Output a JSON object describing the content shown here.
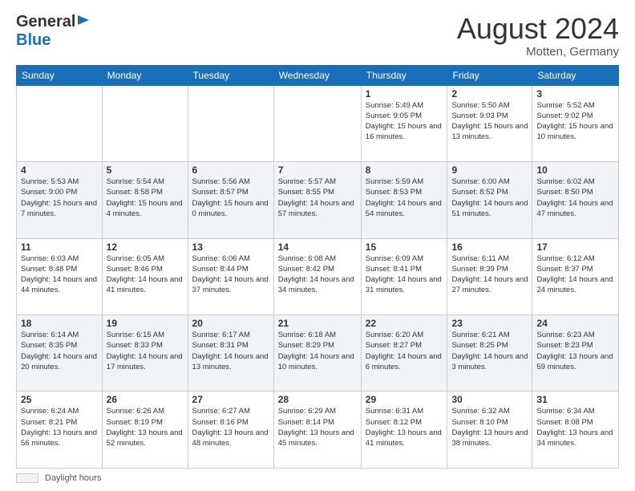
{
  "header": {
    "logo_line1": "General",
    "logo_line2": "Blue",
    "month_title": "August 2024",
    "location": "Motten, Germany"
  },
  "days_of_week": [
    "Sunday",
    "Monday",
    "Tuesday",
    "Wednesday",
    "Thursday",
    "Friday",
    "Saturday"
  ],
  "weeks": [
    [
      {
        "day": "",
        "detail": ""
      },
      {
        "day": "",
        "detail": ""
      },
      {
        "day": "",
        "detail": ""
      },
      {
        "day": "",
        "detail": ""
      },
      {
        "day": "1",
        "detail": "Sunrise: 5:49 AM\nSunset: 9:05 PM\nDaylight: 15 hours and 16 minutes."
      },
      {
        "day": "2",
        "detail": "Sunrise: 5:50 AM\nSunset: 9:03 PM\nDaylight: 15 hours and 13 minutes."
      },
      {
        "day": "3",
        "detail": "Sunrise: 5:52 AM\nSunset: 9:02 PM\nDaylight: 15 hours and 10 minutes."
      }
    ],
    [
      {
        "day": "4",
        "detail": "Sunrise: 5:53 AM\nSunset: 9:00 PM\nDaylight: 15 hours and 7 minutes."
      },
      {
        "day": "5",
        "detail": "Sunrise: 5:54 AM\nSunset: 8:58 PM\nDaylight: 15 hours and 4 minutes."
      },
      {
        "day": "6",
        "detail": "Sunrise: 5:56 AM\nSunset: 8:57 PM\nDaylight: 15 hours and 0 minutes."
      },
      {
        "day": "7",
        "detail": "Sunrise: 5:57 AM\nSunset: 8:55 PM\nDaylight: 14 hours and 57 minutes."
      },
      {
        "day": "8",
        "detail": "Sunrise: 5:59 AM\nSunset: 8:53 PM\nDaylight: 14 hours and 54 minutes."
      },
      {
        "day": "9",
        "detail": "Sunrise: 6:00 AM\nSunset: 8:52 PM\nDaylight: 14 hours and 51 minutes."
      },
      {
        "day": "10",
        "detail": "Sunrise: 6:02 AM\nSunset: 8:50 PM\nDaylight: 14 hours and 47 minutes."
      }
    ],
    [
      {
        "day": "11",
        "detail": "Sunrise: 6:03 AM\nSunset: 8:48 PM\nDaylight: 14 hours and 44 minutes."
      },
      {
        "day": "12",
        "detail": "Sunrise: 6:05 AM\nSunset: 8:46 PM\nDaylight: 14 hours and 41 minutes."
      },
      {
        "day": "13",
        "detail": "Sunrise: 6:06 AM\nSunset: 8:44 PM\nDaylight: 14 hours and 37 minutes."
      },
      {
        "day": "14",
        "detail": "Sunrise: 6:08 AM\nSunset: 8:42 PM\nDaylight: 14 hours and 34 minutes."
      },
      {
        "day": "15",
        "detail": "Sunrise: 6:09 AM\nSunset: 8:41 PM\nDaylight: 14 hours and 31 minutes."
      },
      {
        "day": "16",
        "detail": "Sunrise: 6:11 AM\nSunset: 8:39 PM\nDaylight: 14 hours and 27 minutes."
      },
      {
        "day": "17",
        "detail": "Sunrise: 6:12 AM\nSunset: 8:37 PM\nDaylight: 14 hours and 24 minutes."
      }
    ],
    [
      {
        "day": "18",
        "detail": "Sunrise: 6:14 AM\nSunset: 8:35 PM\nDaylight: 14 hours and 20 minutes."
      },
      {
        "day": "19",
        "detail": "Sunrise: 6:15 AM\nSunset: 8:33 PM\nDaylight: 14 hours and 17 minutes."
      },
      {
        "day": "20",
        "detail": "Sunrise: 6:17 AM\nSunset: 8:31 PM\nDaylight: 14 hours and 13 minutes."
      },
      {
        "day": "21",
        "detail": "Sunrise: 6:18 AM\nSunset: 8:29 PM\nDaylight: 14 hours and 10 minutes."
      },
      {
        "day": "22",
        "detail": "Sunrise: 6:20 AM\nSunset: 8:27 PM\nDaylight: 14 hours and 6 minutes."
      },
      {
        "day": "23",
        "detail": "Sunrise: 6:21 AM\nSunset: 8:25 PM\nDaylight: 14 hours and 3 minutes."
      },
      {
        "day": "24",
        "detail": "Sunrise: 6:23 AM\nSunset: 8:23 PM\nDaylight: 13 hours and 59 minutes."
      }
    ],
    [
      {
        "day": "25",
        "detail": "Sunrise: 6:24 AM\nSunset: 8:21 PM\nDaylight: 13 hours and 56 minutes."
      },
      {
        "day": "26",
        "detail": "Sunrise: 6:26 AM\nSunset: 8:19 PM\nDaylight: 13 hours and 52 minutes."
      },
      {
        "day": "27",
        "detail": "Sunrise: 6:27 AM\nSunset: 8:16 PM\nDaylight: 13 hours and 48 minutes."
      },
      {
        "day": "28",
        "detail": "Sunrise: 6:29 AM\nSunset: 8:14 PM\nDaylight: 13 hours and 45 minutes."
      },
      {
        "day": "29",
        "detail": "Sunrise: 6:31 AM\nSunset: 8:12 PM\nDaylight: 13 hours and 41 minutes."
      },
      {
        "day": "30",
        "detail": "Sunrise: 6:32 AM\nSunset: 8:10 PM\nDaylight: 13 hours and 38 minutes."
      },
      {
        "day": "31",
        "detail": "Sunrise: 6:34 AM\nSunset: 8:08 PM\nDaylight: 13 hours and 34 minutes."
      }
    ]
  ],
  "footer": {
    "legend_label": "Daylight hours"
  }
}
